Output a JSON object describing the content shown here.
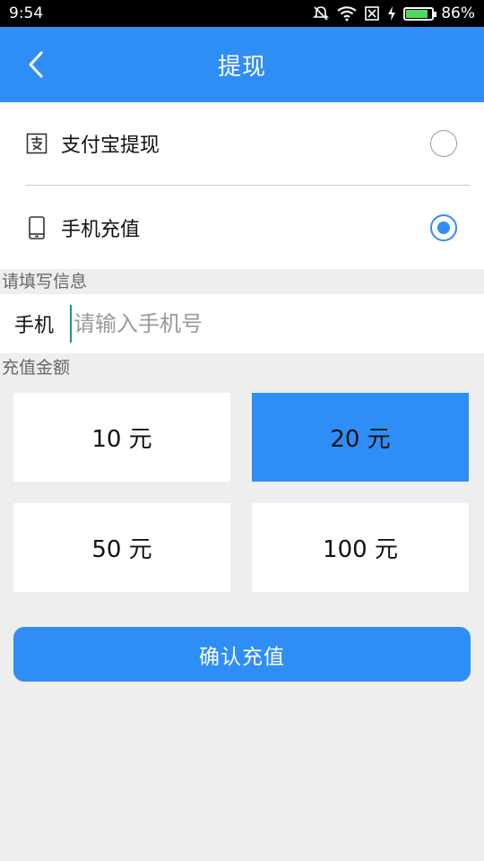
{
  "status_bar": {
    "time": "9:54",
    "battery_text": "86%",
    "battery_level": 0.86,
    "icons": [
      "mute-icon",
      "wifi-icon",
      "sim-icon",
      "charging-icon",
      "battery-icon"
    ]
  },
  "header": {
    "title": "提现",
    "back_icon": "chevron-left-icon"
  },
  "options": [
    {
      "label": "支付宝提现",
      "icon": "alipay-icon",
      "selected": false
    },
    {
      "label": "手机充值",
      "icon": "phone-icon",
      "selected": true
    }
  ],
  "info_section": {
    "title": "请填写信息",
    "phone_label": "手机",
    "phone_value": "",
    "phone_placeholder": "请输入手机号"
  },
  "amount_section": {
    "title": "充值金额",
    "amounts": [
      {
        "label": "10 元",
        "selected": false
      },
      {
        "label": "20 元",
        "selected": true
      },
      {
        "label": "50 元",
        "selected": false
      },
      {
        "label": "100 元",
        "selected": false
      }
    ]
  },
  "confirm_button": {
    "label": "确认充值"
  },
  "colors": {
    "primary": "#2f8ef5",
    "background": "#eeeeee",
    "status_bar": "#000000",
    "battery": "#4cd964"
  }
}
